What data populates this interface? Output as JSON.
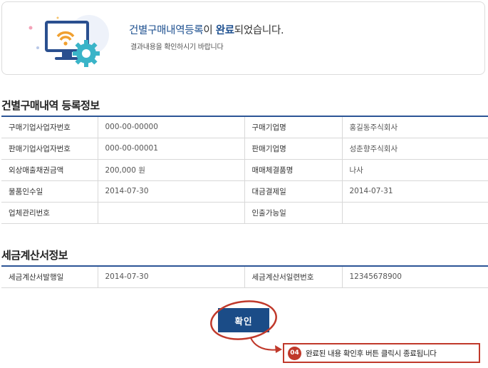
{
  "banner": {
    "title_part1": "건별구매내역등록",
    "title_part2": "이 ",
    "title_part3": "완료",
    "title_part4": "되었습니다.",
    "subtitle": "결과내용을 확인하시기 바랍니다"
  },
  "section1": {
    "title": "건별구매내역 등록정보",
    "rows": [
      [
        {
          "label": "구매기업사업자번호",
          "value": "000-00-00000"
        },
        {
          "label": "구매기업명",
          "value": "홍길동주식회사"
        }
      ],
      [
        {
          "label": "판매기업사업자번호",
          "value": "000-00-00001"
        },
        {
          "label": "판매기업명",
          "value": "성춘향주식회사"
        }
      ],
      [
        {
          "label": "외상매출채권금액",
          "value": "200,000 원"
        },
        {
          "label": "매매체결품명",
          "value": "나사"
        }
      ],
      [
        {
          "label": "물품인수일",
          "value": "2014-07-30"
        },
        {
          "label": "대금결제일",
          "value": "2014-07-31"
        }
      ],
      [
        {
          "label": "업체관리번호",
          "value": ""
        },
        {
          "label": "인출가능일",
          "value": ""
        }
      ]
    ]
  },
  "section2": {
    "title": "세금계산서정보",
    "rows": [
      [
        {
          "label": "세금계산서발행일",
          "value": "2014-07-30"
        },
        {
          "label": "세금계산서일련번호",
          "value": "12345678900"
        }
      ]
    ]
  },
  "confirm_button": {
    "label": "확인"
  },
  "callout": {
    "step": "04",
    "text": "완료된 내용 확인후 버튼 클릭시 종료됩니다"
  },
  "colors": {
    "accent": "#1b4c87",
    "highlight": "#c0392b"
  }
}
